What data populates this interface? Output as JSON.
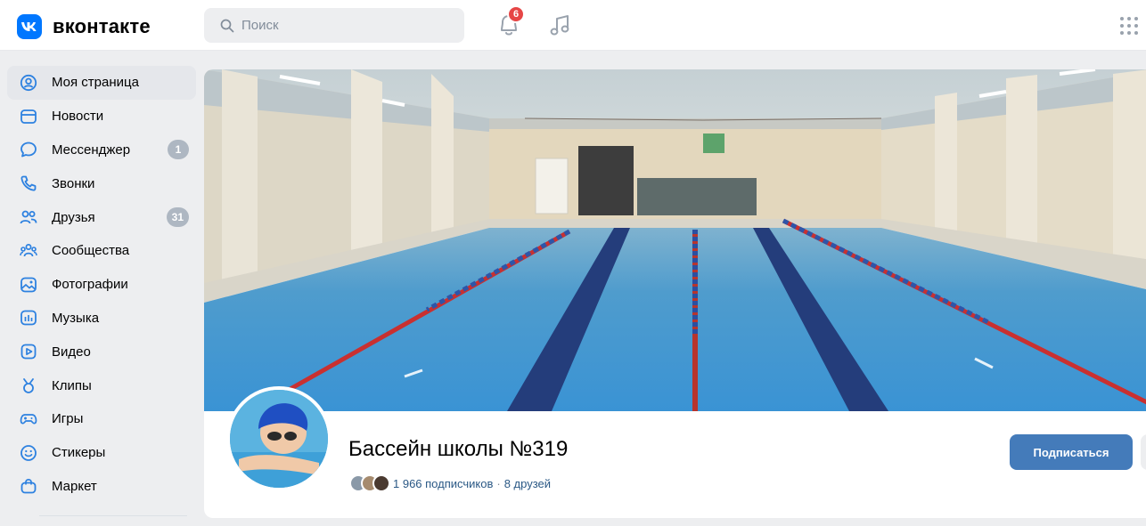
{
  "header": {
    "logo_text": "вконтакте",
    "search_placeholder": "Поиск",
    "notifications_count": "6",
    "brand_color": "#0077ff",
    "badge_color": "#e64646"
  },
  "sidebar": {
    "items": [
      {
        "label": "Моя страница",
        "icon": "profile-icon",
        "badge": ""
      },
      {
        "label": "Новости",
        "icon": "news-icon",
        "badge": ""
      },
      {
        "label": "Мессенджер",
        "icon": "messenger-icon",
        "badge": "1"
      },
      {
        "label": "Звонки",
        "icon": "phone-icon",
        "badge": ""
      },
      {
        "label": "Друзья",
        "icon": "friends-icon",
        "badge": "31"
      },
      {
        "label": "Сообщества",
        "icon": "communities-icon",
        "badge": ""
      },
      {
        "label": "Фотографии",
        "icon": "photos-icon",
        "badge": ""
      },
      {
        "label": "Музыка",
        "icon": "music-icon",
        "badge": ""
      },
      {
        "label": "Видео",
        "icon": "video-icon",
        "badge": ""
      },
      {
        "label": "Клипы",
        "icon": "clips-icon",
        "badge": ""
      },
      {
        "label": "Игры",
        "icon": "games-icon",
        "badge": ""
      },
      {
        "label": "Стикеры",
        "icon": "stickers-icon",
        "badge": ""
      },
      {
        "label": "Маркет",
        "icon": "market-icon",
        "badge": ""
      }
    ]
  },
  "group": {
    "name": "Бассейн школы №319",
    "subscribers": "1 966 подписчиков",
    "separator": "·",
    "friends": "8 друзей",
    "subscribe_label": "Подписаться",
    "accent_color": "#447bba"
  }
}
